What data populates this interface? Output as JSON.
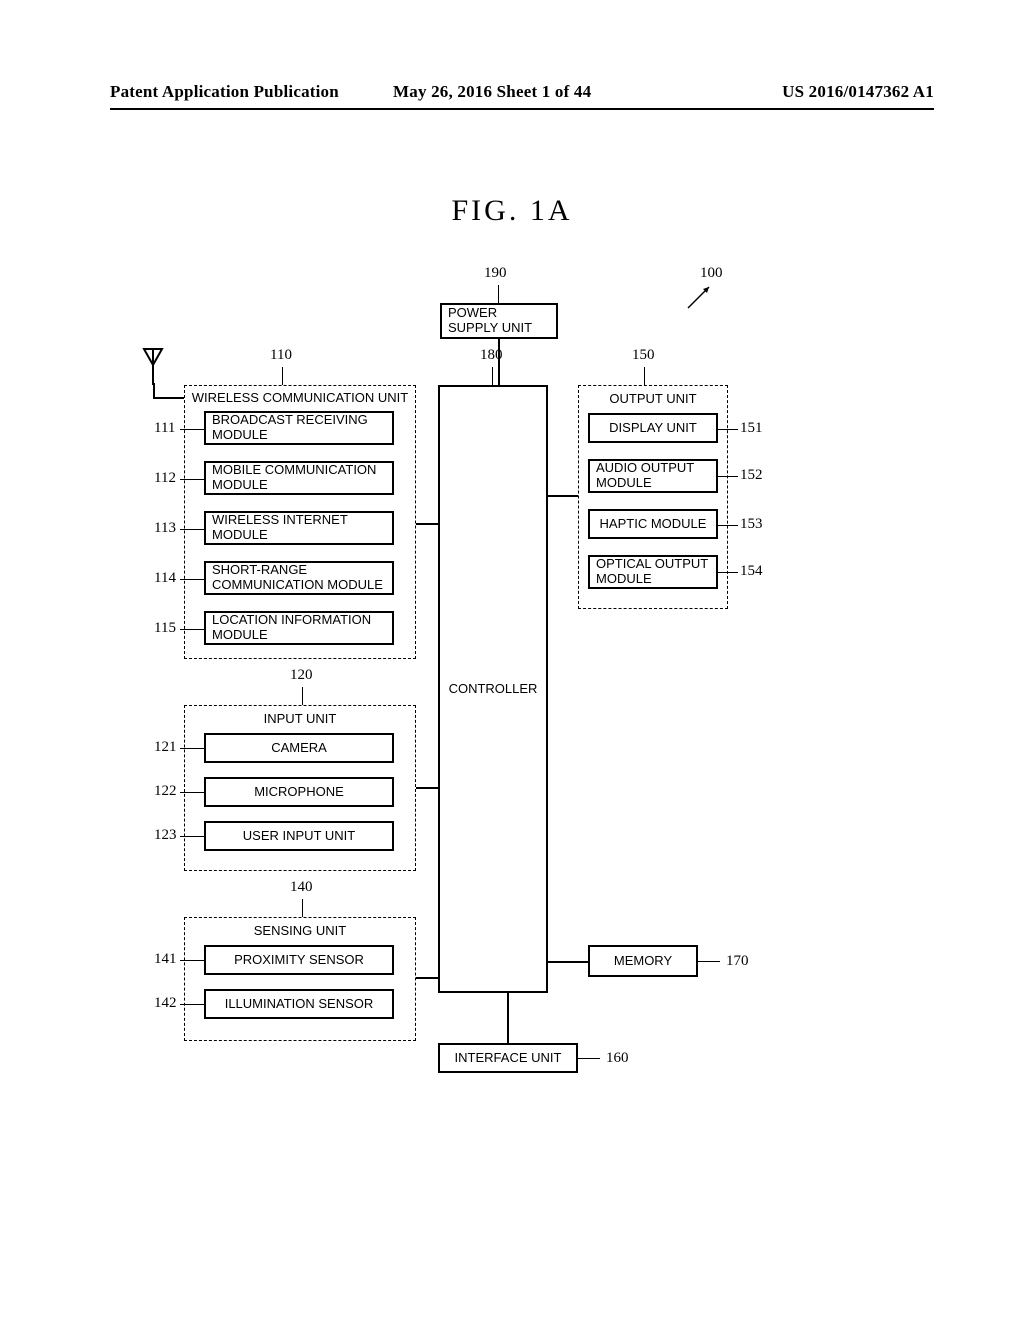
{
  "header": {
    "left": "Patent Application Publication",
    "center": "May 26, 2016  Sheet 1 of 44",
    "right": "US 2016/0147362 A1"
  },
  "figure_title": "FIG.  1A",
  "refs": {
    "r190": "190",
    "r100": "100",
    "r110": "110",
    "r180": "180",
    "r150": "150",
    "r111": "111",
    "r112": "112",
    "r113": "113",
    "r114": "114",
    "r115": "115",
    "r151": "151",
    "r152": "152",
    "r153": "153",
    "r154": "154",
    "r120": "120",
    "r121": "121",
    "r122": "122",
    "r123": "123",
    "r140": "140",
    "r141": "141",
    "r142": "142",
    "r170": "170",
    "r160": "160"
  },
  "blocks": {
    "power_supply": "POWER SUPPLY UNIT",
    "controller": "CONTROLLER",
    "memory": "MEMORY",
    "interface_unit": "INTERFACE UNIT",
    "wireless_comm_unit": "WIRELESS COMMUNICATION UNIT",
    "broadcast": "BROADCAST RECEIVING MODULE",
    "mobile_comm": "MOBILE COMMUNICATION MODULE",
    "wireless_internet": "WIRELESS INTERNET MODULE",
    "short_range": "SHORT-RANGE COMMUNICATION MODULE",
    "location_info": "LOCATION INFORMATION MODULE",
    "input_unit": "INPUT UNIT",
    "camera": "CAMERA",
    "microphone": "MICROPHONE",
    "user_input": "USER INPUT UNIT",
    "sensing_unit": "SENSING UNIT",
    "proximity": "PROXIMITY SENSOR",
    "illumination": "ILLUMINATION SENSOR",
    "output_unit": "OUTPUT UNIT",
    "display_unit": "DISPLAY UNIT",
    "audio_output": "AUDIO OUTPUT MODULE",
    "haptic": "HAPTIC MODULE",
    "optical_output": "OPTICAL OUTPUT MODULE"
  }
}
